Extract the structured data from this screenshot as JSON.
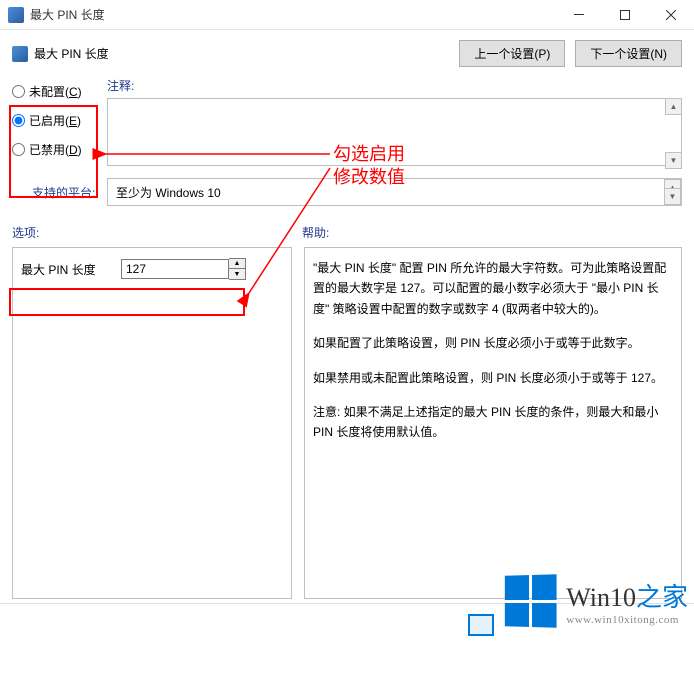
{
  "window": {
    "title": "最大 PIN 长度"
  },
  "header": {
    "title": "最大 PIN 长度",
    "prev_button": "上一个设置(P)",
    "next_button": "下一个设置(N)"
  },
  "radio": {
    "not_configured": "未配置(",
    "not_configured_key": "C",
    "not_configured_suffix": ")",
    "enabled": "已启用(",
    "enabled_key": "E",
    "enabled_suffix": ")",
    "disabled": "已禁用(",
    "disabled_key": "D",
    "disabled_suffix": ")",
    "selected": "enabled"
  },
  "labels": {
    "comment": "注释:",
    "platform": "支持的平台:",
    "options": "选项:",
    "help": "帮助:"
  },
  "platform_value": "至少为 Windows 10",
  "options": {
    "max_pin_label": "最大 PIN 长度",
    "max_pin_value": "127"
  },
  "help": {
    "p1": "\"最大 PIN 长度\" 配置 PIN 所允许的最大字符数。可为此策略设置配置的最大数字是 127。可以配置的最小数字必须大于 \"最小 PIN 长度\" 策略设置中配置的数字或数字 4 (取两者中较大的)。",
    "p2": "如果配置了此策略设置，则 PIN 长度必须小于或等于此数字。",
    "p3": "如果禁用或未配置此策略设置，则 PIN 长度必须小于或等于 127。",
    "p4": "注意: 如果不满足上述指定的最大 PIN 长度的条件，则最大和最小 PIN 长度将使用默认值。"
  },
  "annotations": {
    "line1": "勾选启用",
    "line2": "修改数值"
  },
  "watermark": {
    "brand_en": "Win10",
    "brand_zh": "之家",
    "url": "www.win10xitong.com"
  }
}
